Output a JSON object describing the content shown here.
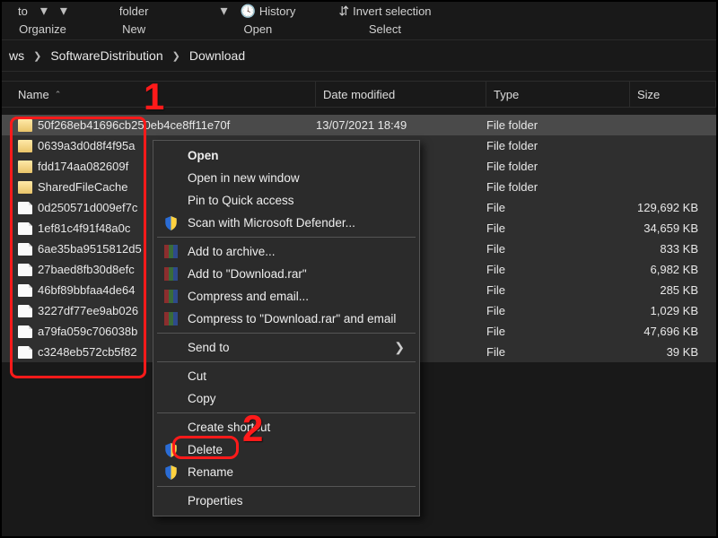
{
  "ribbon": {
    "g1": {
      "to": "to",
      "label": "Organize"
    },
    "g2": {
      "folder": "folder",
      "label": "New"
    },
    "g3": {
      "history": "History",
      "label": "Open"
    },
    "g4": {
      "invert": "Invert selection",
      "label": "Select"
    }
  },
  "breadcrumbs": {
    "a": "ws",
    "b": "SoftwareDistribution",
    "c": "Download"
  },
  "columns": {
    "name": "Name",
    "date": "Date modified",
    "type": "Type",
    "size": "Size"
  },
  "rows": [
    {
      "icon": "folder",
      "name": "50f268eb41696cb250eb4ce8ff11e70f",
      "date": "13/07/2021 18:49",
      "type": "File folder",
      "size": ""
    },
    {
      "icon": "folder",
      "name": "0639a3d0d8f4f95a",
      "date": "",
      "type": "File folder",
      "size": ""
    },
    {
      "icon": "folder",
      "name": "fdd174aa082609f",
      "date": "",
      "type": "File folder",
      "size": ""
    },
    {
      "icon": "folder",
      "name": "SharedFileCache",
      "date": "",
      "type": "File folder",
      "size": ""
    },
    {
      "icon": "file",
      "name": "0d250571d009ef7c",
      "date": "",
      "type": "File",
      "size": "129,692 KB"
    },
    {
      "icon": "file",
      "name": "1ef81c4f91f48a0c",
      "date": "",
      "type": "File",
      "size": "34,659 KB"
    },
    {
      "icon": "file",
      "name": "6ae35ba9515812d5",
      "date": "",
      "type": "File",
      "size": "833 KB"
    },
    {
      "icon": "file",
      "name": "27baed8fb30d8efc",
      "date": "",
      "type": "File",
      "size": "6,982 KB"
    },
    {
      "icon": "file",
      "name": "46bf89bbfaa4de64",
      "date": "",
      "type": "File",
      "size": "285 KB"
    },
    {
      "icon": "file",
      "name": "3227df77ee9ab026",
      "date": "",
      "type": "File",
      "size": "1,029 KB"
    },
    {
      "icon": "file",
      "name": "a79fa059c706038b",
      "date": "",
      "type": "File",
      "size": "47,696 KB"
    },
    {
      "icon": "file",
      "name": "c3248eb572cb5f82",
      "date": "",
      "type": "File",
      "size": "39 KB"
    }
  ],
  "ctx": {
    "open": "Open",
    "open_new": "Open in new window",
    "pin": "Pin to Quick access",
    "defender": "Scan with Microsoft Defender...",
    "archive": "Add to archive...",
    "addrar": "Add to \"Download.rar\"",
    "email": "Compress and email...",
    "emailrar": "Compress to \"Download.rar\" and email",
    "sendto": "Send to",
    "cut": "Cut",
    "copy": "Copy",
    "shortcut": "Create shortcut",
    "delete": "Delete",
    "rename": "Rename",
    "props": "Properties"
  },
  "annotations": {
    "n1": "1",
    "n2": "2"
  }
}
